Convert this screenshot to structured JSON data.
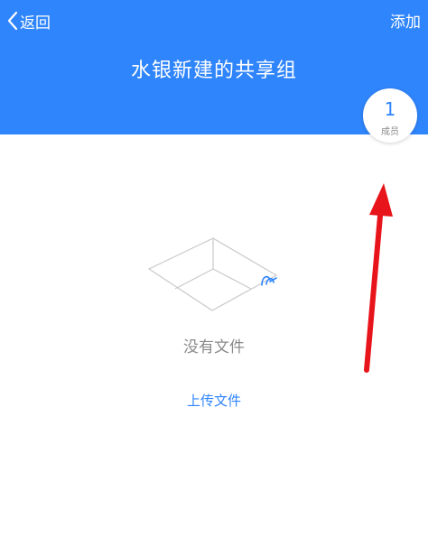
{
  "header": {
    "back_label": "返回",
    "add_label": "添加",
    "title": "水银新建的共享组"
  },
  "members": {
    "count": "1",
    "label": "成员"
  },
  "empty_state": {
    "message": "没有文件",
    "upload_label": "上传文件"
  },
  "colors": {
    "primary": "#2f85fb",
    "annotation": "#e8141b"
  },
  "icons": {
    "back": "chevron-left-icon",
    "empty": "empty-box-icon"
  }
}
